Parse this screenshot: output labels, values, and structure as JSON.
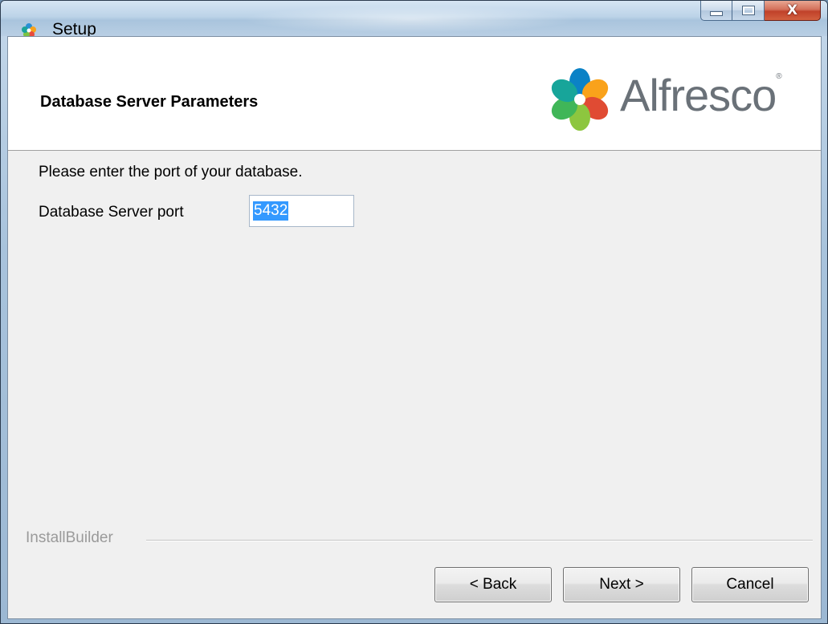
{
  "window": {
    "title": "Setup",
    "caption_buttons": {
      "minimize": "minimize-icon",
      "maximize": "maximize-icon",
      "close": "close-icon"
    }
  },
  "header": {
    "title": "Database Server Parameters",
    "logo_text": "Alfresco",
    "logo_mark": "®"
  },
  "main": {
    "instruction": "Please enter the port of your database.",
    "port_label": "Database Server port",
    "port_value": "5432"
  },
  "footer": {
    "group_label": "InstallBuilder",
    "back_label": "< Back",
    "next_label": "Next >",
    "cancel_label": "Cancel"
  },
  "colors": {
    "selection": "#3399ff",
    "logo_text": "#6a7178",
    "client_bg": "#f0f0f0"
  }
}
